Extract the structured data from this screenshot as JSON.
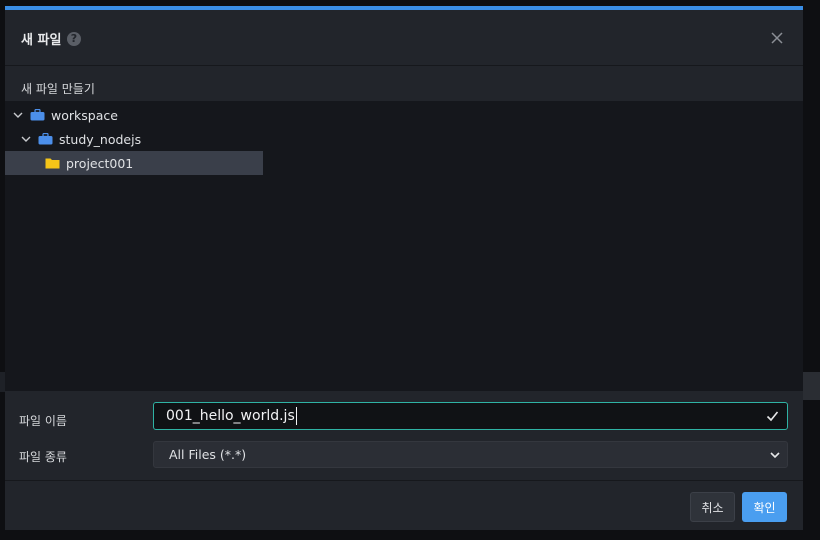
{
  "dialog": {
    "title": "새 파일",
    "help_icon": "?",
    "section_label": "새 파일 만들기"
  },
  "tree": {
    "items": [
      {
        "label": "workspace",
        "icon": "briefcase-icon",
        "expanded": true
      },
      {
        "label": "study_nodejs",
        "icon": "briefcase-icon",
        "expanded": true
      },
      {
        "label": "project001",
        "icon": "folder-icon",
        "selected": true
      }
    ]
  },
  "form": {
    "name_label": "파일 이름",
    "name_value": "001_hello_world.js",
    "type_label": "파일 종류",
    "type_value": "All Files (*.*)"
  },
  "buttons": {
    "cancel": "취소",
    "ok": "확인"
  },
  "colors": {
    "accent": "#3a8ee6",
    "input_border": "#2fb3a4",
    "ok_button": "#4a9ef0",
    "briefcase": "#4c8fea",
    "folder": "#f5c518"
  }
}
